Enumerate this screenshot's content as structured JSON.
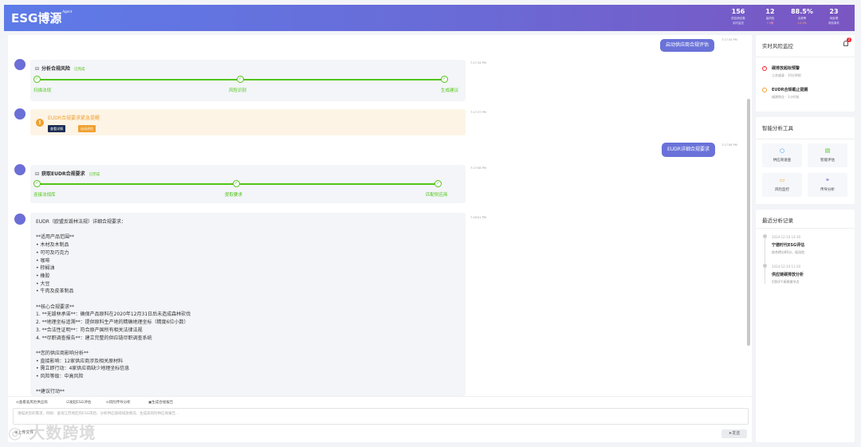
{
  "header": {
    "logo": "ESG博源",
    "logo_sup": "Agent",
    "stats": [
      {
        "value": "156",
        "label": "供应商总数",
        "sub": "实时监控",
        "sub_color": "#dfe3ff"
      },
      {
        "value": "12",
        "label": "高风险",
        "sub": "↑3家",
        "sub_color": "#ff9fb0"
      },
      {
        "value": "88.5%",
        "label": "合规率",
        "sub": "↓2.3%",
        "sub_color": "#ffb37a"
      },
      {
        "value": "23",
        "label": "待处理",
        "sub": "风险事件",
        "sub_color": "#dfe3ff"
      }
    ]
  },
  "chat": {
    "msg1": {
      "text": "启动供应商合规评估",
      "time": "7:17:34 PM"
    },
    "card1": {
      "title": "分析合规风险",
      "status": "已完成",
      "time": "7:17:34 PM",
      "steps": [
        "扫描法规",
        "风险识别",
        "生成建议"
      ]
    },
    "alert": {
      "title": "EUDR合规要求紧急提醒",
      "btn1": "查看详情",
      "btn2": "启动评估",
      "time": "7:17:37 PM"
    },
    "msg2": {
      "text": "EUDR详细合规要求",
      "time": "7:17:58 PM"
    },
    "card2": {
      "title": "获取EUDR合规要求",
      "status": "已完成",
      "time": "7:17:58 PM",
      "steps": [
        "连接法规库",
        "提取要求",
        "匹配供应商"
      ]
    },
    "detail": {
      "time": "7:18:01 PM",
      "lines": [
        "EUDR（欧盟反毁林法规）详细合规要求：",
        "",
        "**适用产品范围**",
        "• 木材及木制品",
        "• 可可及巧克力",
        "• 咖啡",
        "• 棕榈油",
        "• 橡胶",
        "• 大豆",
        "• 牛肉及皮革制品",
        "",
        "**核心合规要求**",
        "1. **无毁林承诺**：确保产品原料在2020年12月31日后未造成森林砍伐",
        "2. **地理坐标追溯**：提供原料生产地的精确地理坐标（精度6位小数）",
        "3. **合法性证明**：符合原产国所有相关法律法规",
        "4. **尽职调查报告**：建立完整的供应链尽职调查系统",
        "",
        "**您的供应商影响分析**",
        "• 直接影响：12家供应商涉及相关原材料",
        "• 需立即行动：4家供应商缺少地理坐标信息",
        "• 风险等级：中高风险",
        "",
        "**建议行动**"
      ]
    }
  },
  "bottom": {
    "quick_actions": [
      "⊙查看高风险供应商",
      "☑发起ESG评估",
      "⊙风险传导分析",
      "▣生成合规报告"
    ],
    "input_placeholder": "请描述您的需求，例如：查询江苏地区的ESG风险、分析供应链碳排放情况、生成高风险供应商报告...",
    "upload": "⊕上传文件",
    "send": "➤发送"
  },
  "sidebar": {
    "monitor": {
      "title": "实时风险监控",
      "badge": "2",
      "items": [
        {
          "title": "碳排放超标预警",
          "sub": "江苏盛泰 · 10分钟前",
          "color": "#f5222d",
          "icon": "warning-icon"
        },
        {
          "title": "EUDR合规截止提醒",
          "sub": "福建商业 · 1小时前",
          "color": "#f0a030",
          "icon": "clock-icon"
        }
      ]
    },
    "tools": {
      "title": "智能分析工具",
      "items": [
        {
          "label": "供应商速查",
          "glyph": "○",
          "color": "#1890ff",
          "icon": "search-icon"
        },
        {
          "label": "智能评估",
          "glyph": "▤",
          "color": "#52c41a",
          "icon": "document-icon"
        },
        {
          "label": "风险监控",
          "glyph": "▭",
          "color": "#f0a030",
          "icon": "monitor-icon"
        },
        {
          "label": "传导分析",
          "glyph": "⚭",
          "color": "#8a5cd6",
          "icon": "link-icon"
        }
      ]
    },
    "records": {
      "title": "最近分析记录",
      "items": [
        {
          "date": "2024-12-10 14:30",
          "title": "宁德时代ESG评估",
          "sub": "综合得分85分，低风险"
        },
        {
          "date": "2024-12-10 11:20",
          "title": "供应链碳排放分析",
          "sub": "识别3个高排放节点"
        }
      ]
    }
  },
  "watermark": "大数跨境"
}
